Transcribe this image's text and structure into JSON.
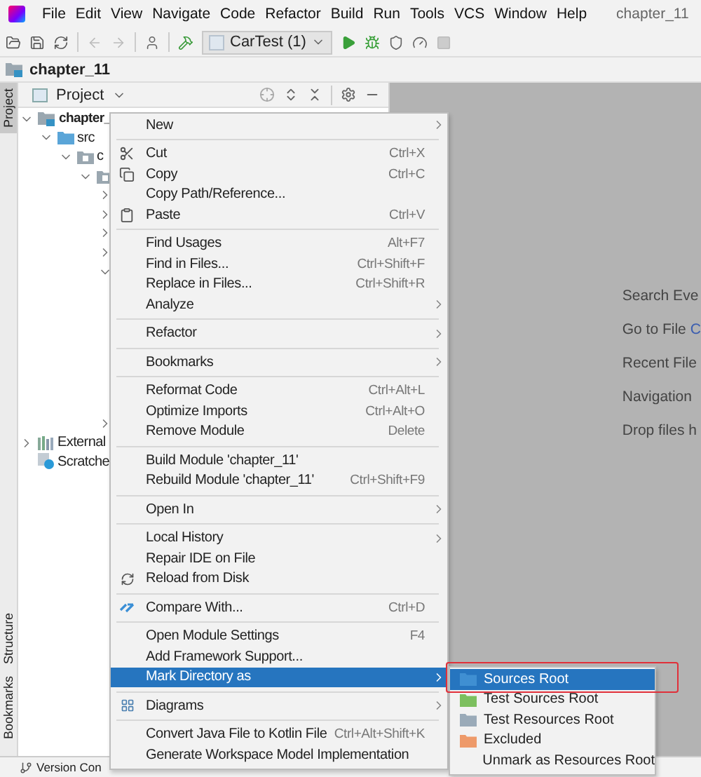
{
  "menubar": {
    "items": [
      "File",
      "Edit",
      "View",
      "Navigate",
      "Code",
      "Refactor",
      "Build",
      "Run",
      "Tools",
      "VCS",
      "Window",
      "Help"
    ],
    "title": "chapter_11"
  },
  "toolbar": {
    "run_config": "CarTest (1)"
  },
  "breadcrumb": "chapter_11",
  "tool_windows": [
    {
      "label": "Project",
      "selected": true,
      "kind": "top"
    },
    {
      "label": "Structure",
      "selected": false,
      "kind": "bottom"
    },
    {
      "label": "Bookmarks",
      "selected": false,
      "kind": "bottom"
    }
  ],
  "project_panel": {
    "title": "Project",
    "tree": [
      {
        "label": "chapter_",
        "kind": "module",
        "expanded": true,
        "children": [
          {
            "label": "src",
            "kind": "source",
            "expanded": true,
            "children": [
              {
                "label": "c",
                "kind": "package",
                "expanded": true,
                "children": [
                  {
                    "kind": "package",
                    "expanded": true,
                    "children": [
                      {
                        "expanded": false
                      },
                      {
                        "expanded": false
                      },
                      {
                        "expanded": false
                      },
                      {
                        "expanded": false
                      },
                      {
                        "expanded": true
                      },
                      {
                        "expanded": false
                      }
                    ]
                  }
                ]
              }
            ]
          }
        ]
      }
    ],
    "tree_bottom": [
      {
        "label": "External",
        "kind": "library",
        "expanded": false
      },
      {
        "label": "Scratche",
        "kind": "scratch"
      }
    ]
  },
  "editor_hints": [
    {
      "label": "Search Eve"
    },
    {
      "label": "Go to File",
      "shortcut": "C"
    },
    {
      "label": "Recent File"
    },
    {
      "label": "Navigation"
    },
    {
      "label": "Drop files h"
    }
  ],
  "status_bar": {
    "label": "Version Con"
  },
  "context_menu": [
    [
      {
        "label": "New",
        "submenu": true,
        "selected": false
      }
    ],
    [
      {
        "label": "Cut",
        "shortcut": "Ctrl+X",
        "selected": false
      },
      {
        "label": "Copy",
        "shortcut": "Ctrl+C",
        "selected": false
      },
      {
        "label": "Copy Path/Reference...",
        "selected": false
      },
      {
        "label": "Paste",
        "shortcut": "Ctrl+V",
        "selected": false
      }
    ],
    [
      {
        "label": "Find Usages",
        "shortcut": "Alt+F7",
        "selected": false
      },
      {
        "label": "Find in Files...",
        "shortcut": "Ctrl+Shift+F",
        "selected": false
      },
      {
        "label": "Replace in Files...",
        "shortcut": "Ctrl+Shift+R",
        "selected": false
      },
      {
        "label": "Analyze",
        "submenu": true,
        "selected": false
      }
    ],
    [
      {
        "label": "Refactor",
        "submenu": true,
        "selected": false
      }
    ],
    [
      {
        "label": "Bookmarks",
        "submenu": true,
        "selected": false
      }
    ],
    [
      {
        "label": "Reformat Code",
        "shortcut": "Ctrl+Alt+L",
        "selected": false
      },
      {
        "label": "Optimize Imports",
        "shortcut": "Ctrl+Alt+O",
        "selected": false
      },
      {
        "label": "Remove Module",
        "shortcut": "Delete",
        "selected": false
      }
    ],
    [
      {
        "label": "Build Module 'chapter_11'",
        "selected": false
      },
      {
        "label": "Rebuild Module 'chapter_11'",
        "shortcut": "Ctrl+Shift+F9",
        "selected": false
      }
    ],
    [
      {
        "label": "Open In",
        "submenu": true,
        "selected": false
      }
    ],
    [
      {
        "label": "Local History",
        "submenu": true,
        "selected": false
      },
      {
        "label": "Repair IDE on File",
        "selected": false
      },
      {
        "label": "Reload from Disk",
        "selected": false
      }
    ],
    [
      {
        "label": "Compare With...",
        "shortcut": "Ctrl+D",
        "selected": false
      }
    ],
    [
      {
        "label": "Open Module Settings",
        "shortcut": "F4",
        "selected": false
      },
      {
        "label": "Add Framework Support...",
        "selected": false
      },
      {
        "label": "Mark Directory as",
        "submenu": true,
        "selected": true
      }
    ],
    [
      {
        "label": "Diagrams",
        "submenu": true,
        "selected": false
      }
    ],
    [
      {
        "label": "Convert Java File to Kotlin File",
        "shortcut": "Ctrl+Alt+Shift+K",
        "selected": false
      },
      {
        "label": "Generate Workspace Model Implementation",
        "selected": false
      }
    ]
  ],
  "submenu": [
    {
      "label": "Sources Root",
      "color": "#3f8fd2",
      "selected": true,
      "highlighted": true
    },
    {
      "label": "Test Sources Root",
      "color": "#7cbf5e",
      "selected": false,
      "highlighted": false
    },
    {
      "label": "Test Resources Root",
      "color": "#9aaab8",
      "selected": false,
      "highlighted": false
    },
    {
      "label": "Excluded",
      "color": "#ee9a6a",
      "selected": false,
      "highlighted": false
    },
    {
      "label": "Unmark as Resources Root",
      "selected": false,
      "highlighted": false
    }
  ]
}
